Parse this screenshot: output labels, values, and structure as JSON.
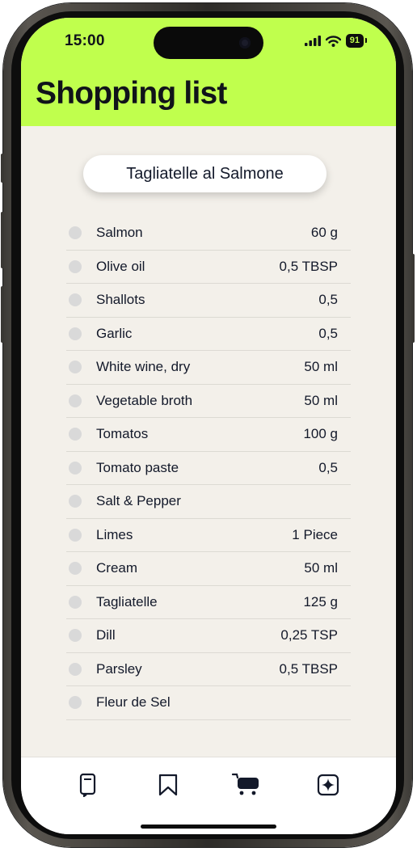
{
  "status_bar": {
    "time": "15:00",
    "battery": "91"
  },
  "header": {
    "title": "Shopping list"
  },
  "recipe": {
    "name": "Tagliatelle al Salmone"
  },
  "items": [
    {
      "name": "Salmon",
      "qty": "60 g"
    },
    {
      "name": "Olive oil",
      "qty": "0,5 TBSP"
    },
    {
      "name": "Shallots",
      "qty": "0,5"
    },
    {
      "name": "Garlic",
      "qty": "0,5"
    },
    {
      "name": "White wine, dry",
      "qty": "50 ml"
    },
    {
      "name": "Vegetable broth",
      "qty": "50 ml"
    },
    {
      "name": "Tomatos",
      "qty": "100 g"
    },
    {
      "name": "Tomato paste",
      "qty": "0,5"
    },
    {
      "name": "Salt & Pepper",
      "qty": ""
    },
    {
      "name": "Limes",
      "qty": "1 Piece"
    },
    {
      "name": "Cream",
      "qty": "50 ml"
    },
    {
      "name": "Tagliatelle",
      "qty": "125 g"
    },
    {
      "name": "Dill",
      "qty": "0,25 TSP"
    },
    {
      "name": "Parsley",
      "qty": "0,5 TBSP"
    },
    {
      "name": "Fleur de Sel",
      "qty": ""
    }
  ],
  "tabbar": {
    "tabs": [
      "recipes-icon",
      "bookmark-icon",
      "cart-icon",
      "sparkle-icon"
    ],
    "active": "cart-icon"
  },
  "colors": {
    "accent": "#c0ff4d",
    "background": "#f3f0ea",
    "text": "#13192a",
    "checkbox": "#d9d9d9"
  }
}
